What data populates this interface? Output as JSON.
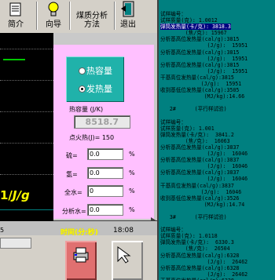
{
  "toolbar": {
    "buttons": [
      {
        "label": "简介",
        "icon": "document-icon"
      },
      {
        "label": "向导",
        "icon": "lightbulb-icon"
      },
      {
        "label": "煤质分析方法",
        "icon": "book-icon"
      },
      {
        "label": "退出",
        "icon": "exit-door-icon"
      }
    ]
  },
  "calorimeter": {
    "mode_options": [
      "热容量",
      "发热量"
    ],
    "selected_mode": "发热量",
    "heat_capacity_label": "热容量 (J/K)",
    "heat_capacity_value": "8518.7",
    "ignition_heat_label": "点火热(J)= 150",
    "fields": [
      {
        "label": "硫=",
        "value": "0.0",
        "unit": "%"
      },
      {
        "label": "氢=",
        "value": "0.0",
        "unit": "%"
      },
      {
        "label": "全水=",
        "value": "0",
        "unit": "%"
      },
      {
        "label": "分析水=",
        "value": "0.0",
        "unit": "%"
      }
    ]
  },
  "chart": {
    "unit_label": "J/g",
    "x_axis_label": "时间(分:秒)",
    "time_readout": "18:08",
    "left_tick": "5"
  },
  "results": {
    "highlighted_line": "弹筒发热量(卡/克): 3818.3",
    "lines_before": [
      "试样编号：",
      "试样质量(克): 1.0012"
    ],
    "lines_after": [
      "        (焦/克): 15967",
      "分析基高位发热量(cal/g):3815",
      "               (J/g):  15951",
      "分析基高位发热量(cal/g):3815",
      "               (J/g):  15951",
      "分析基高位发热量(cal/g):3815",
      "               (J/g):  15951",
      "干基高位发热量(cal/g):3815",
      "             (J/g):  15951",
      "收到基低位发热量(cal/g):3505",
      "              (MJ/kg):14.66",
      "",
      "   2#      (平行样试验)",
      "",
      "试样编号：",
      "试样质量(克): 1.001",
      "弹筒发热量(卡/克):  3841.2",
      "        (焦/克):  16063",
      "分析基高位发热量(cal/g):3837",
      "               (J/g):  16046",
      "分析基高位发热量(cal/g):3837",
      "               (J/g):  16046",
      "分析基高位发热量(cal/g):3837",
      "               (J/g):  16046",
      "干基高位发热量(cal/g):3837",
      "             (J/g):  16046",
      "收到基低位发热量(cal/g):3526",
      "              (MJ/kg):14.74",
      "",
      "   3#      (平行样试验)",
      "",
      "试样编号：",
      "试样质量(克): 1.0118",
      "弹筒发热量(卡/克):  6330.3",
      "        (焦/克):  26504",
      "分析基高位发热量(cal/g):6328",
      "               (J/g):  26462",
      "分析基高位发热量(cal/g):6328",
      "               (J/g):  26462",
      "干基高位发热量(cal/g):6328"
    ]
  },
  "colors": {
    "panel_bg": "#008080",
    "pink_bg": "#ffc0ff",
    "chart_bg": "#000000",
    "highlight": "#000080"
  }
}
